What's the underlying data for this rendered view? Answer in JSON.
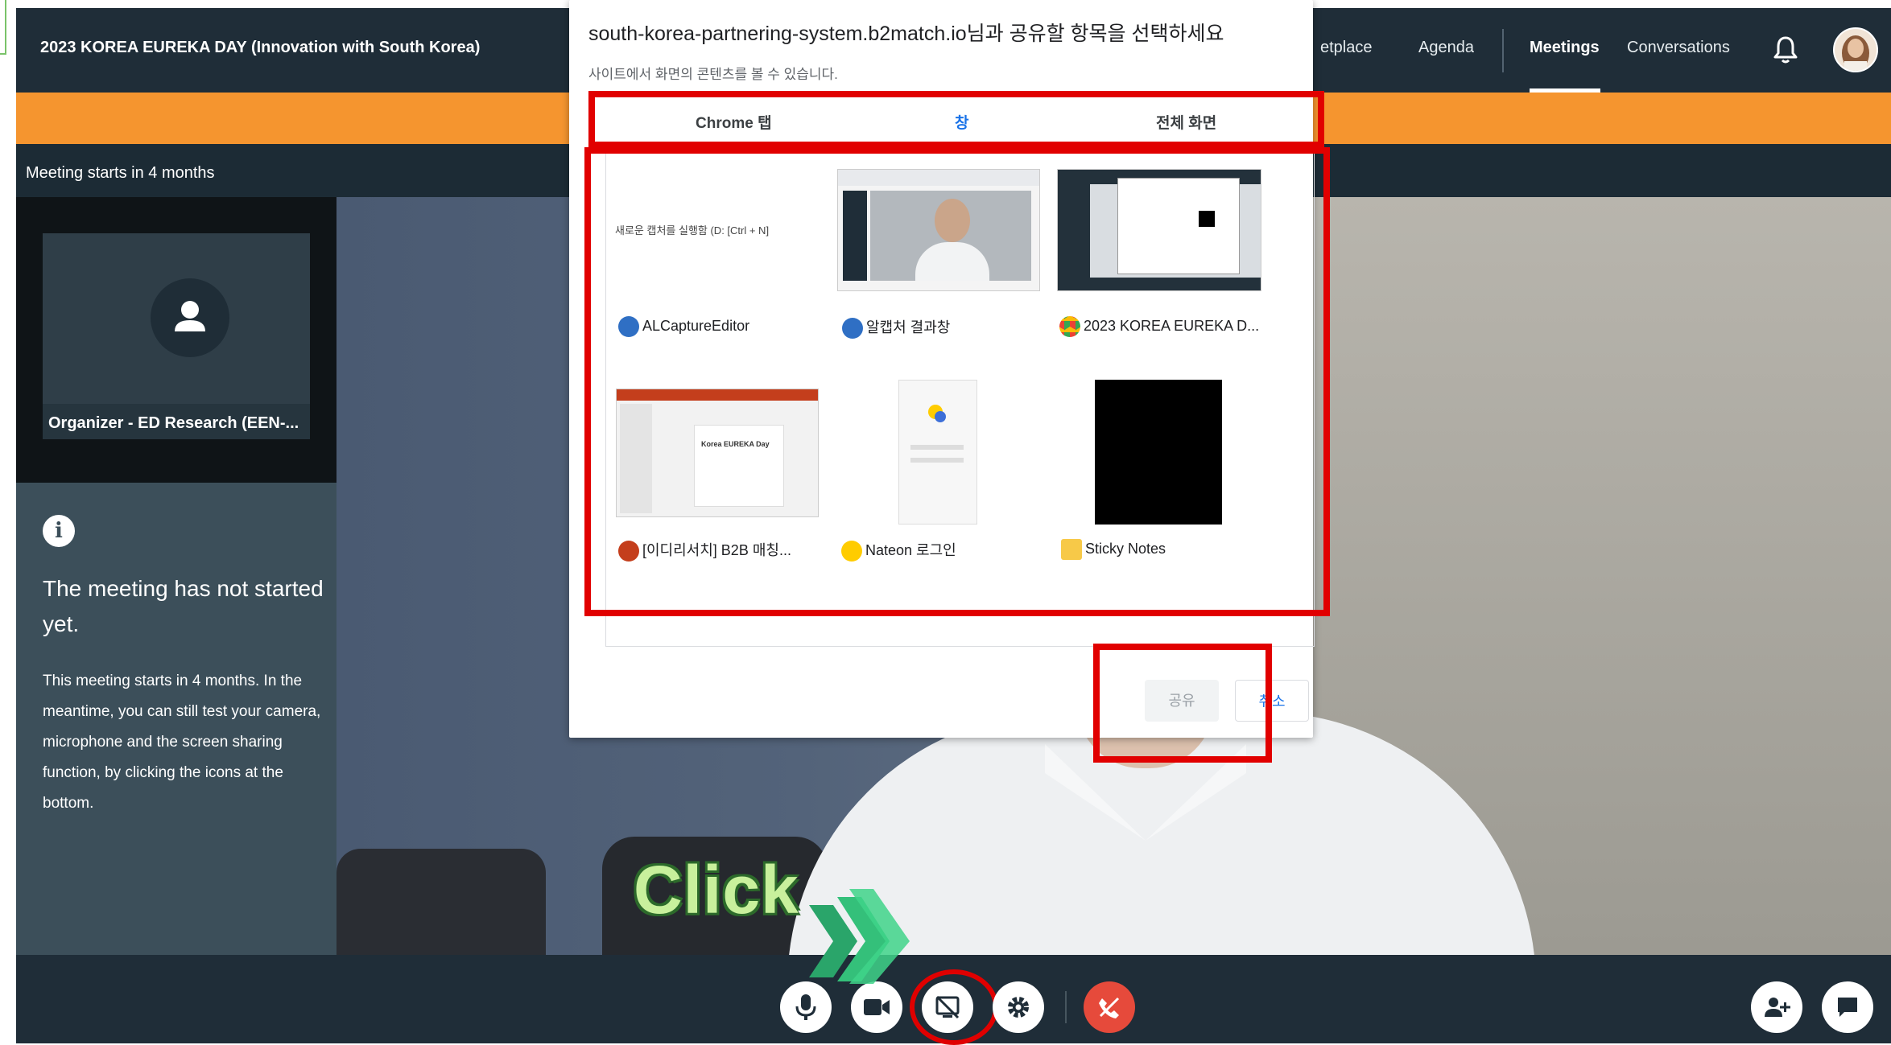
{
  "app": {
    "title": "2023 KOREA EUREKA DAY (Innovation with South Korea)",
    "nav": [
      "etplace",
      "Agenda",
      "Meetings",
      "Conversations"
    ],
    "active_nav": "Meetings"
  },
  "status": {
    "meeting_starts": "Meeting starts in 4 months"
  },
  "participant": {
    "label": "Organizer - ED Research (EEN-..."
  },
  "info": {
    "title": "The meeting has not started yet.",
    "body": "This meeting starts in 4 months. In the meantime, you can still test your camera, microphone and the screen sharing function, by clicking the icons at the bottom."
  },
  "dialog": {
    "title": "south-korea-partnering-system.b2match.io님과 공유할 항목을 선택하세요",
    "subtitle": "사이트에서 화면의 콘텐츠를 볼 수 있습니다.",
    "tabs": [
      "Chrome 탭",
      "창",
      "전체 화면"
    ],
    "active_tab": "창",
    "windows": [
      {
        "label": "ALCaptureEditor",
        "thumb_text": "새로운 캡처를 실행함 (D: [Ctrl + N]"
      },
      {
        "label": "알캡처 결과창"
      },
      {
        "label": "2023 KOREA EUREKA D..."
      },
      {
        "label": "[이디리서치] B2B 매칭...",
        "thumb_text": "Korea EUREKA Day"
      },
      {
        "label": "Nateon 로그인"
      },
      {
        "label": "Sticky Notes"
      }
    ],
    "share_label": "공유",
    "cancel_label": "취소"
  },
  "annotation": {
    "click_label": "Click"
  },
  "colors": {
    "orange": "#f5952f",
    "dark": "#1f2d38",
    "highlight": "#e10000",
    "accent": "#1a73e8"
  }
}
